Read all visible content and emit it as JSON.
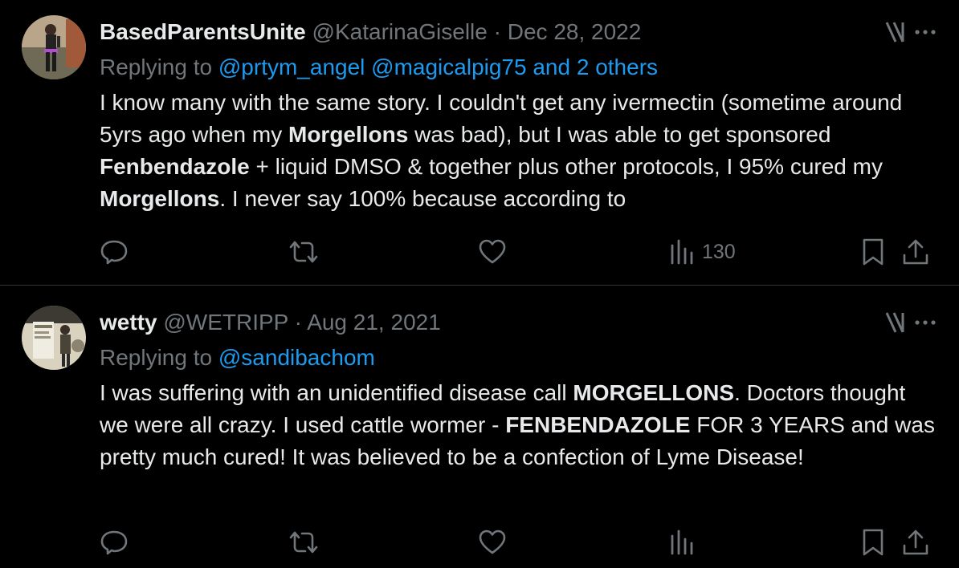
{
  "tweets": [
    {
      "display_name": "BasedParentsUnite",
      "handle": "@KatarinaGiselle",
      "separator": "·",
      "date": "Dec 28, 2022",
      "replying_prefix": "Replying to ",
      "mentions": "@prtym_angel @magicalpig75 and 2 others",
      "body": {
        "p1": "I know many with the same story. I couldn't get any ivermectin (sometime around 5yrs ago when my ",
        "b1": "Morgellons",
        "p2": " was bad), but I was able to get sponsored ",
        "b2": "Fenbendazole",
        "p3": " + liquid DMSO & together plus other protocols, I 95% cured my ",
        "b3": "Morgellons",
        "p4": ". I never say 100% because according to"
      },
      "views": "130",
      "icons": [
        "xai-grok-icon",
        "more-icon",
        "reply-icon",
        "retweet-icon",
        "like-icon",
        "views-icon",
        "bookmark-icon",
        "share-icon"
      ]
    },
    {
      "display_name": "wetty",
      "handle": "@WETRIPP",
      "separator": "·",
      "date": "Aug 21, 2021",
      "replying_prefix": "Replying to ",
      "mentions": "@sandibachom",
      "body": {
        "p1": "I was suffering with an unidentified disease call ",
        "b1": "MORGELLONS",
        "p2": ". Doctors thought we were all crazy. I used cattle wormer - ",
        "b2": "FENBENDAZOLE",
        "p3": " FOR 3 YEARS and was pretty much cured! It was believed to be a confection of Lyme Disease!"
      },
      "views": "",
      "icons": [
        "xai-grok-icon",
        "more-icon",
        "reply-icon",
        "retweet-icon",
        "like-icon",
        "views-icon",
        "bookmark-icon",
        "share-icon"
      ]
    }
  ],
  "colors": {
    "background": "#000000",
    "text": "#e7e9ea",
    "muted": "#71767b",
    "link": "#1d9bf0",
    "divider": "#2f3336"
  }
}
